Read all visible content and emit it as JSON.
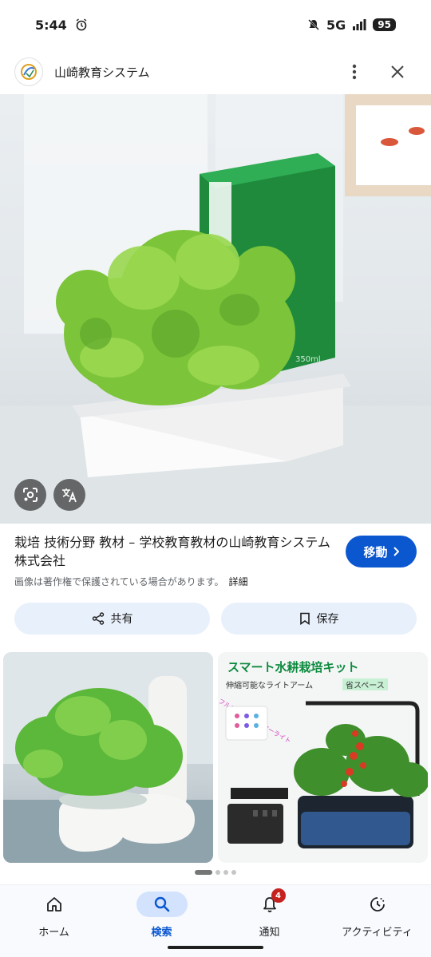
{
  "status_bar": {
    "time": "5:44",
    "network": "5G",
    "battery": "95"
  },
  "app_bar": {
    "site_name": "山崎教育システム"
  },
  "result": {
    "title": "栽培 技術分野 教材 – 学校教育教材の山崎教育システム株式会社",
    "visit_label": "移動",
    "copyright_notice": "画像は著作権で保護されている場合があります。",
    "details_label": "詳細"
  },
  "actions": {
    "share_label": "共有",
    "save_label": "保存"
  },
  "hero_image": {
    "box_text": "350ml"
  },
  "related": {
    "promo_title": "スマート水耕栽培キット",
    "promo_sub": "伸縮可能なライトアーム",
    "promo_tag": "省スペース",
    "promo_vertical": "フルスペクトルグローライト"
  },
  "bottom_nav": {
    "items": [
      {
        "label": "ホーム",
        "icon": "home-icon"
      },
      {
        "label": "検索",
        "icon": "search-icon"
      },
      {
        "label": "通知",
        "icon": "bell-icon",
        "badge": "4"
      },
      {
        "label": "アクティビティ",
        "icon": "activity-icon"
      }
    ]
  },
  "colors": {
    "accent": "#0b57d0",
    "pill_bg": "#e8f0fb",
    "nav_active_bg": "#d3e3fd",
    "badge": "#c5221f"
  }
}
